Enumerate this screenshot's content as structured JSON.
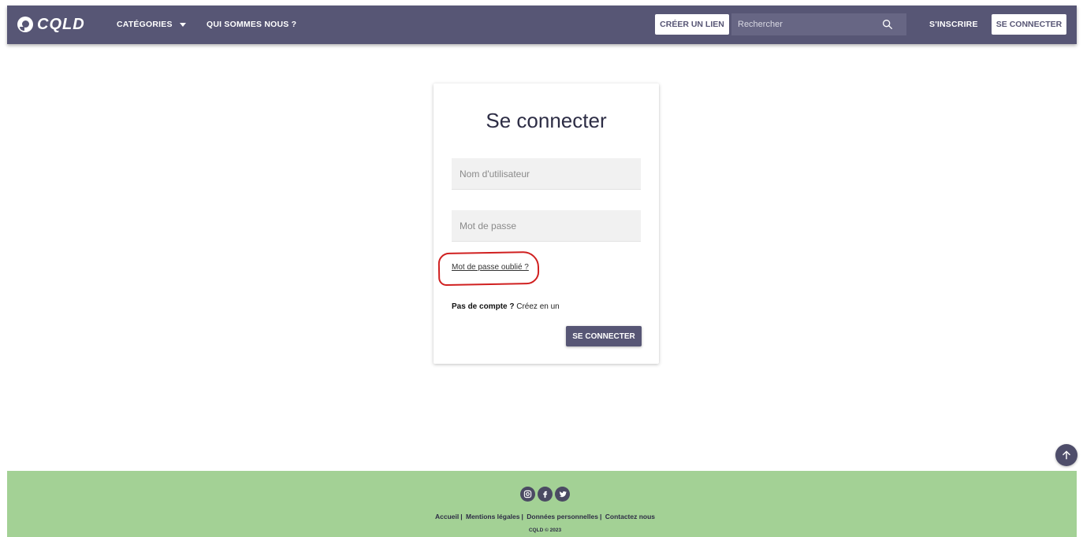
{
  "header": {
    "logo_text": "CQLD",
    "nav": {
      "categories_label": "CATÉGORIES",
      "about_label": "QUI SOMMES NOUS ?"
    },
    "create_link_label": "CRÉER UN LIEN",
    "search": {
      "placeholder": "Rechercher"
    },
    "signup_label": "S'INSCRIRE",
    "login_label": "SE CONNECTER"
  },
  "login_card": {
    "title": "Se connecter",
    "username_placeholder": "Nom d'utilisateur",
    "password_placeholder": "Mot de passe",
    "forgot_password": "Mot de passe oublié ?",
    "no_account_label": "Pas de compte ?",
    "create_account_link": "Créez en un",
    "submit_label": "SE CONNECTER"
  },
  "footer": {
    "links": [
      "Accueil",
      "Mentions légales",
      "Données personnelles",
      "Contactez nous"
    ],
    "copyright": "CQLD © 2023",
    "socials": [
      "instagram-icon",
      "facebook-icon",
      "twitter-icon"
    ]
  },
  "colors": {
    "primary": "#575675",
    "footer_bg": "#a3d195",
    "annotation": "#d02020"
  }
}
